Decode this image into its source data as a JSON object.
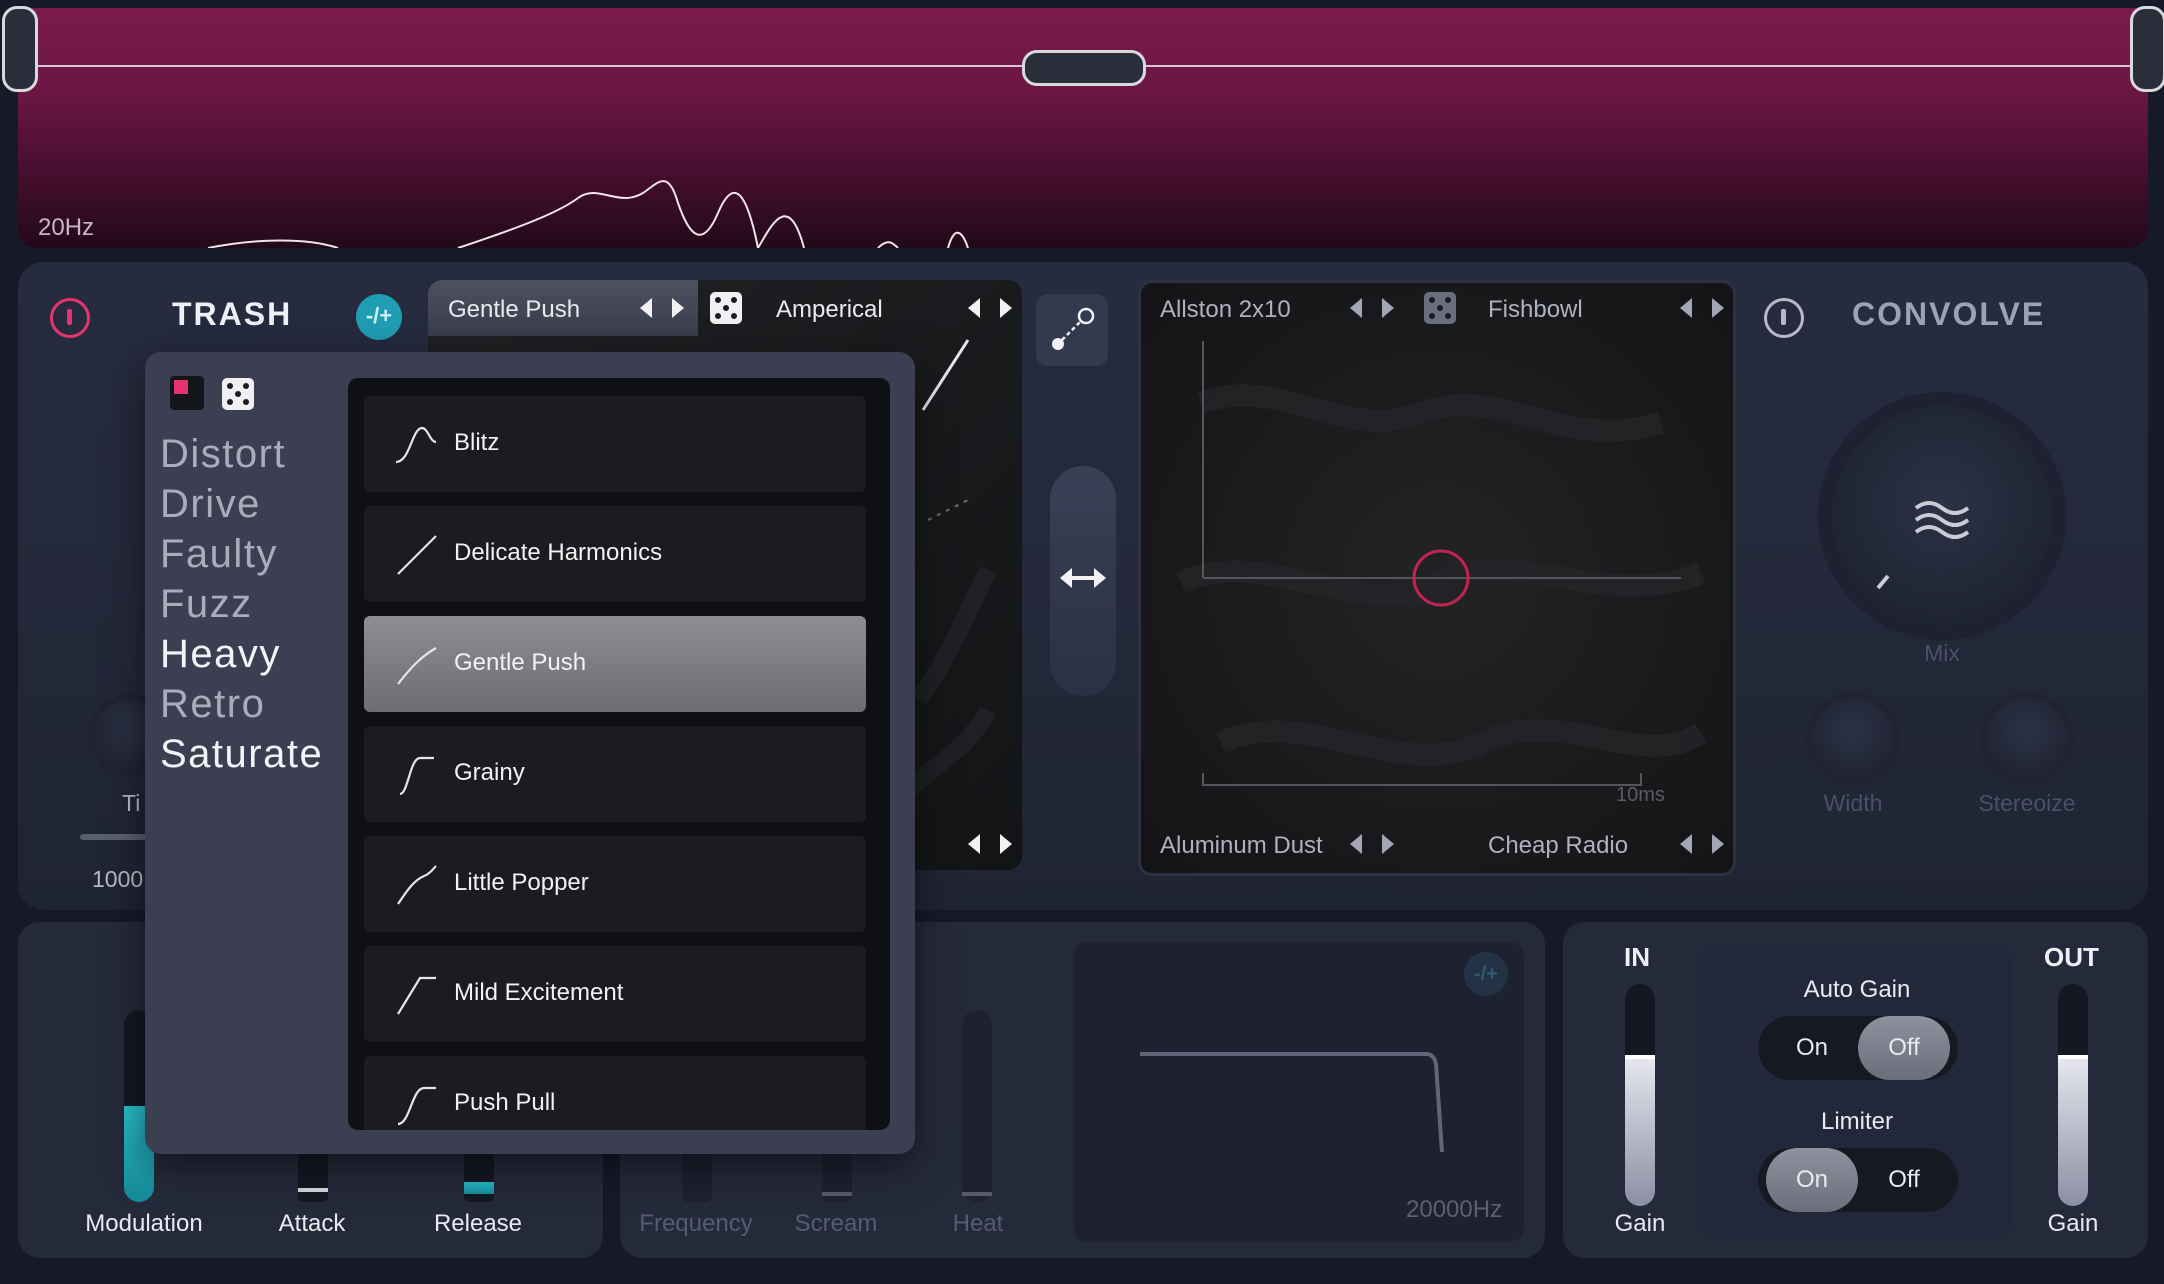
{
  "spectrum": {
    "low_freq_label": "20Hz"
  },
  "trash": {
    "title": "TRASH",
    "mix_chip": "-/+",
    "partial_labels": [
      "Ti",
      "1000"
    ]
  },
  "saturate_slot": {
    "preset": "Gentle Push",
    "algorithm": "Amperical"
  },
  "convolve_slots": {
    "top_left": "Allston 2x10",
    "top_right": "Fishbowl",
    "bottom_left": "Aluminum Dust",
    "bottom_right": "Cheap Radio",
    "time_label": "10ms"
  },
  "convolve": {
    "title": "CONVOLVE",
    "knobs": {
      "mix": "Mix",
      "width": "Width",
      "stereoize": "Stereoize"
    }
  },
  "dropdown": {
    "styles": [
      {
        "label": "Distort",
        "bright": false
      },
      {
        "label": "Drive",
        "bright": false
      },
      {
        "label": "Faulty",
        "bright": false
      },
      {
        "label": "Fuzz",
        "bright": false
      },
      {
        "label": "Heavy",
        "bright": true
      },
      {
        "label": "Retro",
        "bright": false
      },
      {
        "label": "Saturate",
        "bright": true
      }
    ],
    "presets": [
      {
        "label": "Blitz",
        "selected": false
      },
      {
        "label": "Delicate Harmonics",
        "selected": false
      },
      {
        "label": "Gentle Push",
        "selected": true
      },
      {
        "label": "Grainy",
        "selected": false
      },
      {
        "label": "Little Popper",
        "selected": false
      },
      {
        "label": "Mild Excitement",
        "selected": false
      },
      {
        "label": "Push Pull",
        "selected": false
      }
    ]
  },
  "envelope": {
    "labels": {
      "modulation": "Modulation",
      "attack": "Attack",
      "release": "Release"
    }
  },
  "filter": {
    "labels": {
      "frequency": "Frequency",
      "scream": "Scream",
      "heat": "Heat"
    },
    "high_freq_label": "20000Hz",
    "mix_chip": "-/+"
  },
  "io": {
    "in_label": "IN",
    "out_label": "OUT",
    "in_gain_label": "Gain",
    "out_gain_label": "Gain",
    "in_level": 0.66,
    "out_level": 0.66,
    "auto_gain": {
      "label": "Auto Gain",
      "on": "On",
      "off": "Off",
      "active": "off"
    },
    "limiter": {
      "label": "Limiter",
      "on": "On",
      "off": "Off",
      "active": "on"
    }
  },
  "colors": {
    "accent": "#e6336e",
    "teal": "#1f9db3",
    "spectrum": "#6b1644"
  },
  "icons": [
    "power-icon",
    "dice-icon",
    "link-icon",
    "swap-icon",
    "waveform-icon",
    "chevron-left-icon",
    "chevron-right-icon"
  ]
}
